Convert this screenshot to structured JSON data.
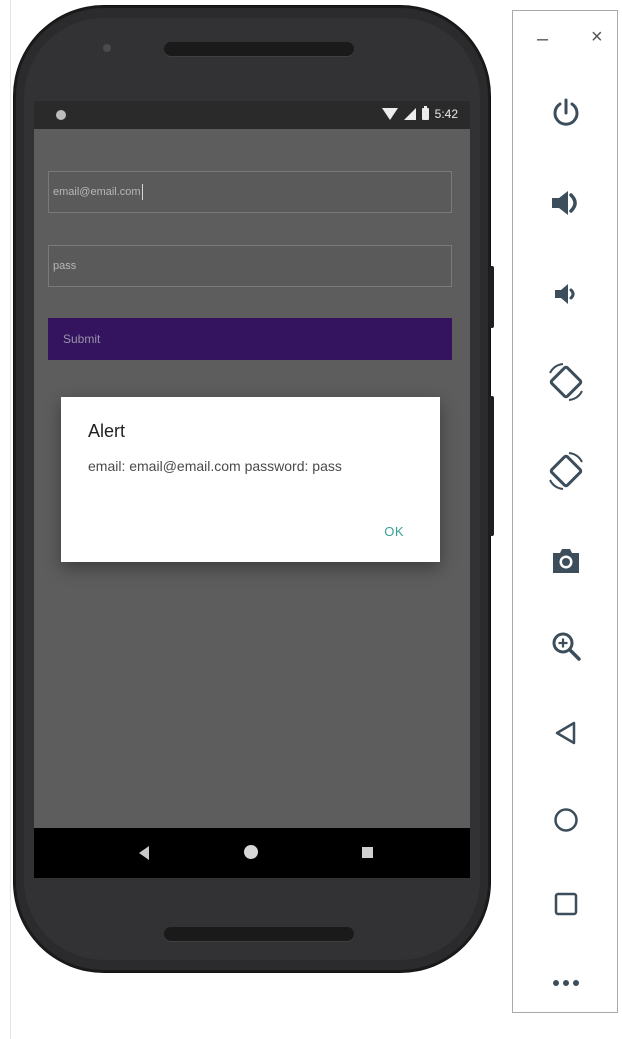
{
  "status_bar": {
    "time": "5:42"
  },
  "form": {
    "email_value": "email@email.com",
    "password_value": "pass",
    "submit_label": "Submit"
  },
  "dialog": {
    "title": "Alert",
    "message": "email: email@email.com password: pass",
    "ok_label": "OK"
  },
  "navbar": {
    "icons": [
      "back-icon",
      "home-icon",
      "recents-icon"
    ]
  },
  "emulator_toolbar": {
    "minimize_label": "–",
    "close_label": "×",
    "buttons": [
      "power-icon",
      "volume-up-icon",
      "volume-down-icon",
      "rotate-left-icon",
      "rotate-right-icon",
      "camera-icon",
      "zoom-icon",
      "back-icon",
      "home-icon",
      "overview-icon",
      "more-icon"
    ]
  },
  "colors": {
    "accent_purple": "#34135F",
    "dialog_ok": "#3A9F95",
    "screen_dim": "#5D5D5D",
    "toolbar_icon": "#3C4E5B"
  }
}
